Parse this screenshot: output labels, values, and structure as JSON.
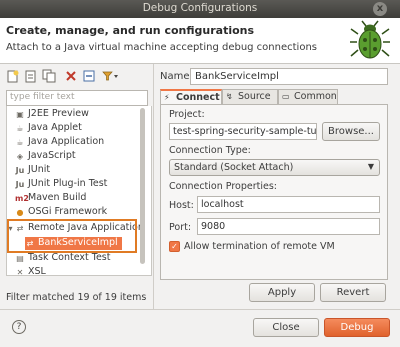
{
  "window": {
    "title": "Debug Configurations",
    "close_glyph": "x"
  },
  "header": {
    "title": "Create, manage, and run configurations",
    "subtitle": "Attach to a Java virtual machine accepting debug connections"
  },
  "left": {
    "filter_placeholder": "type filter text",
    "tree": [
      {
        "label": "J2EE Preview",
        "icon": "j2ee-icon",
        "indent": 0
      },
      {
        "label": "Java Applet",
        "icon": "applet-icon",
        "indent": 0
      },
      {
        "label": "Java Application",
        "icon": "java-app-icon",
        "indent": 0
      },
      {
        "label": "JavaScript",
        "icon": "javascript-icon",
        "indent": 0
      },
      {
        "label": "JUnit",
        "icon": "junit-icon",
        "indent": 0
      },
      {
        "label": "JUnit Plug-in Test",
        "icon": "junit-plugin-icon",
        "indent": 0
      },
      {
        "label": "Maven Build",
        "icon": "maven-icon",
        "indent": 0
      },
      {
        "label": "OSGi Framework",
        "icon": "osgi-icon",
        "indent": 0
      },
      {
        "label": "Remote Java Application",
        "icon": "remote-java-icon",
        "indent": 0
      },
      {
        "label": "BankServiceImpl",
        "icon": "remote-config-icon",
        "indent": 1,
        "selected": true
      },
      {
        "label": "Task Context Test",
        "icon": "task-context-icon",
        "indent": 0
      },
      {
        "label": "XSL",
        "icon": "xsl-icon",
        "indent": 0
      }
    ],
    "status": "Filter matched 19 of 19 items"
  },
  "right": {
    "name_label": "Name:",
    "name_value": "BankServiceImpl",
    "tabs": [
      {
        "label": "Connect",
        "active": true
      },
      {
        "label": "Source",
        "active": false
      },
      {
        "label": "Common",
        "active": false
      }
    ],
    "project_label": "Project:",
    "project_value": "test-spring-security-sample-tuto",
    "browse_label": "Browse...",
    "conn_type_label": "Connection Type:",
    "conn_type_value": "Standard (Socket Attach)",
    "conn_props_label": "Connection Properties:",
    "host_label": "Host:",
    "host_value": "localhost",
    "port_label": "Port:",
    "port_value": "9080",
    "allow_term_label": "Allow termination of remote VM",
    "apply_label": "Apply",
    "revert_label": "Revert"
  },
  "footer": {
    "help_glyph": "?",
    "close_label": "Close",
    "debug_label": "Debug"
  },
  "colors": {
    "accent": "#f07746",
    "highlight_box": "#e07b24"
  }
}
